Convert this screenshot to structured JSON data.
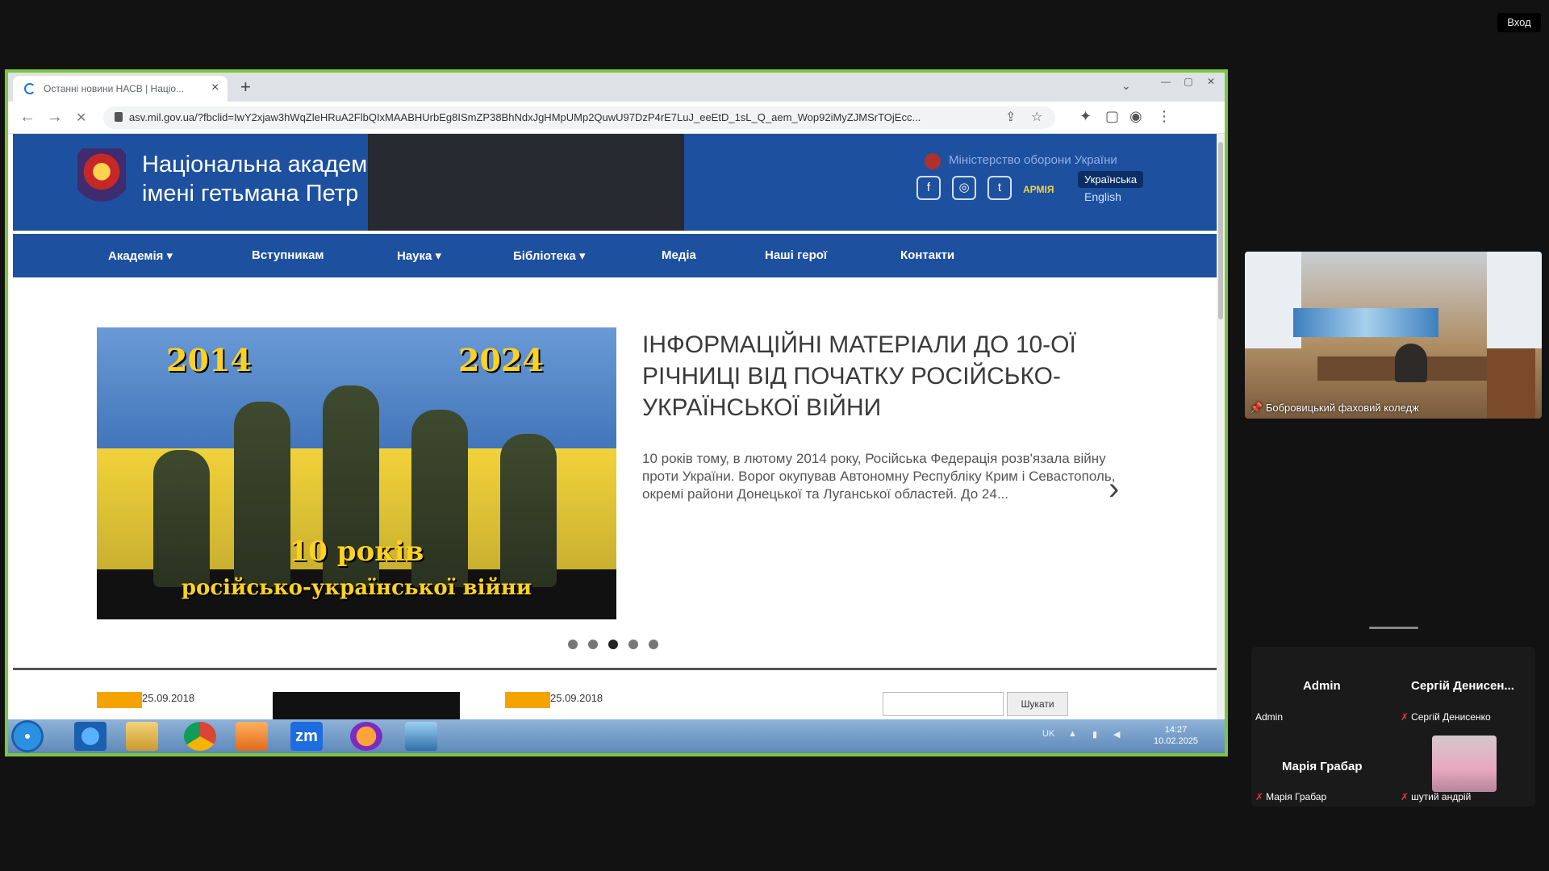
{
  "zoom": {
    "signin_label": "Вход"
  },
  "browser": {
    "tab_title": "Останні новини НАСВ | Націо...",
    "tab_close": "×",
    "new_tab": "+",
    "tab_dropdown": "⌄",
    "window_controls": [
      "—",
      "▢",
      "✕"
    ],
    "back": "←",
    "forward": "→",
    "reload": "✕",
    "url": "asv.mil.gov.ua/?fbclid=IwY2xjaw3hWqZleHRuA2FlbQIxMAABHUrbEg8ISmZP38BhNdxJgHMpUMp2QuwU97DzP4rE7LuJ_eeEtD_1sL_Q_aem_Wop92iMyZJMSrTOjEcc...",
    "omni_icons": [
      "share-icon",
      "star-icon"
    ],
    "toolbar_icons": [
      "extensions-icon",
      "sidepanel-icon",
      "profile-icon",
      "menu-icon"
    ]
  },
  "site": {
    "title_line1": "Національна академ",
    "title_line2": "імені гетьмана Петр",
    "ministry": "Міністерство оборони України",
    "social": [
      "f",
      "◎",
      "t"
    ],
    "armia": "АРМІЯ",
    "lang_ua": "Українська",
    "lang_en": "English",
    "nav": [
      "Академія ▾",
      "Вступникам",
      "Наука ▾",
      "Бібліотека ▾",
      "Медіа",
      "Наші герої",
      "Контакти"
    ],
    "slide": {
      "year_left": "2014",
      "year_right": "2024",
      "years_caption": "10 років",
      "war_caption": "російсько-української війни",
      "title": "ІНФОРМАЦІЙНІ МАТЕРІАЛИ ДО 10-ОЇ РІЧНИЦІ ВІД ПОЧАТКУ РОСІЙСЬКО-УКРАЇНСЬКОЇ ВІЙНИ",
      "text": "10 років тому, в лютому 2014 року, Російська Федерація розв'язала війну проти України. Ворог окупував Автономну Республіку Крим і Севастополь, окремі райони Донецької та Луганської областей. До 24...",
      "next": "›",
      "dots_count": 5,
      "active_dot": 3
    },
    "news_dates": [
      "25.09.2018",
      "25.09.2018"
    ],
    "search_button": "Шукати"
  },
  "taskbar": {
    "apps": [
      "ie-icon",
      "explorer-icon",
      "chrome-icon",
      "media-player-icon",
      "zoom-icon",
      "firefox-icon",
      "photos-icon"
    ],
    "zoom_label": "zm",
    "lang": "UK",
    "time": "14:27",
    "date": "10.02.2025"
  },
  "video": {
    "label": "Бобровицький фаховий коледж"
  },
  "participants": [
    {
      "name": "Admin",
      "label": "Admin",
      "muted": false
    },
    {
      "name": "Сергій Денисен...",
      "label": "Сергій Денисенко",
      "muted": true
    },
    {
      "name": "Марія Грабар",
      "label": "Марія Грабар",
      "muted": true
    },
    {
      "name": "",
      "label": "шутий андрій",
      "muted": true
    }
  ],
  "colors": {
    "share_border": "#7cc63d",
    "site_blue": "#1e50a0",
    "accent_orange": "#f5a300"
  }
}
